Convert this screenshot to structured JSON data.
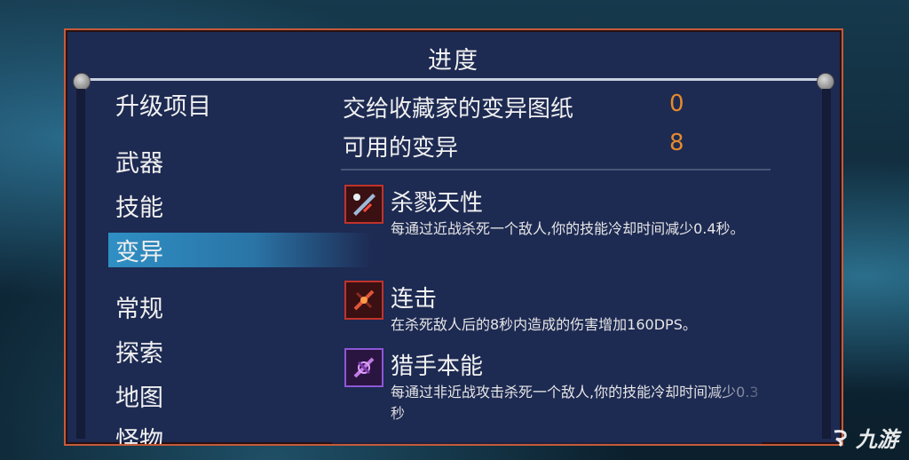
{
  "panel": {
    "title": "进度"
  },
  "left": {
    "heading": "升级项目",
    "items": [
      {
        "label": "武器",
        "active": false
      },
      {
        "label": "技能",
        "active": false
      },
      {
        "label": "变异",
        "active": true
      },
      {
        "label": "常规",
        "active": false
      },
      {
        "label": "探索",
        "active": false
      },
      {
        "label": "地图",
        "active": false
      },
      {
        "label": "怪物",
        "active": false
      }
    ]
  },
  "stats": [
    {
      "label": "交给收藏家的变异图纸",
      "value": "0"
    },
    {
      "label": "可用的变异",
      "value": "8"
    }
  ],
  "mutations": [
    {
      "name": "杀戮天性",
      "icon": "killer-instinct-icon",
      "frame_color": "#c0332b",
      "desc": "每通过近战杀死一个敌人,你的技能冷却时间减少0.4秒。"
    },
    {
      "name": "连击",
      "icon": "combo-icon",
      "frame_color": "#c0332b",
      "desc": "在杀死敌人后的8秒内造成的伤害增加160DPS。"
    },
    {
      "name": "猎手本能",
      "icon": "hunter-instinct-icon",
      "frame_color": "#8e56d6",
      "desc": "每通过非近战攻击杀死一个敌人,你的技能冷却时间减少0.3秒"
    }
  ],
  "colors": {
    "border": "#c45b3b",
    "panel": "#1d2a52",
    "value": "#e58a2c",
    "active": "#2f8fc4"
  },
  "watermark": "九游"
}
